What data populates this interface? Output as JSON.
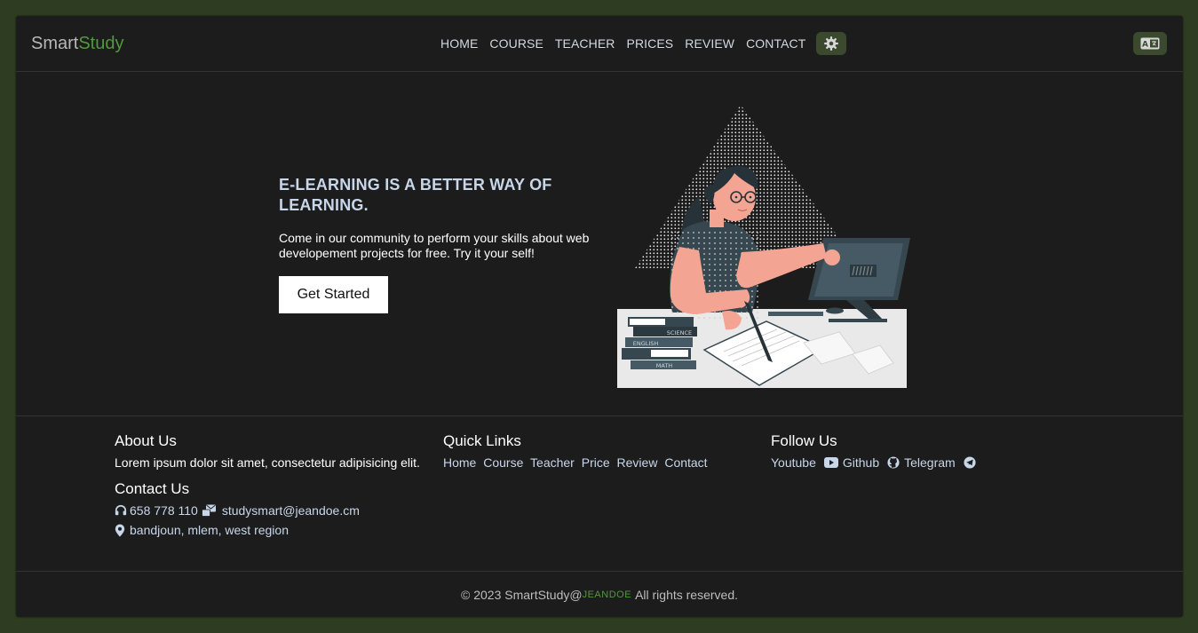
{
  "header": {
    "logo_part1": "Smart",
    "logo_part2": "Study",
    "nav": [
      "HOME",
      "COURSE",
      "TEACHER",
      "PRICES",
      "REVIEW",
      "CONTACT"
    ],
    "theme_icon": "gear-icon",
    "lang_icon": "translate-icon"
  },
  "hero": {
    "title_line1": "E-LEARNING IS A BETTER WAY OF",
    "title_line2": "LEARNING.",
    "text": "Come in our community to perform your skills about web developement projects for free. Try it your self!",
    "cta": "Get Started",
    "book_labels": [
      "SCIENCE",
      "ENGLISH",
      "MATH"
    ]
  },
  "footer": {
    "about": {
      "title": "About Us",
      "text": "Lorem ipsum dolor sit amet, consectetur adipisicing elit."
    },
    "contact": {
      "title": "Contact Us",
      "phone": "658 778 110",
      "email": "studysmart@jeandoe.cm",
      "address": "bandjoun, mlem, west region"
    },
    "quick_links": {
      "title": "Quick Links",
      "items": [
        "Home",
        "Course",
        "Teacher",
        "Price",
        "Review",
        "Contact"
      ]
    },
    "follow": {
      "title": "Follow Us",
      "items": [
        {
          "label": "Youtube",
          "icon": "youtube-icon"
        },
        {
          "label": "Github",
          "icon": "github-icon"
        },
        {
          "label": "Telegram",
          "icon": "telegram-icon"
        }
      ]
    }
  },
  "copyright": {
    "prefix": "© 2023 SmartStudy@",
    "brand": "JEANDOE",
    "suffix": "All rights reserved."
  },
  "colors": {
    "accent": "#4f9a3c",
    "background": "#1c1c1c",
    "outer": "#2e3d21"
  }
}
